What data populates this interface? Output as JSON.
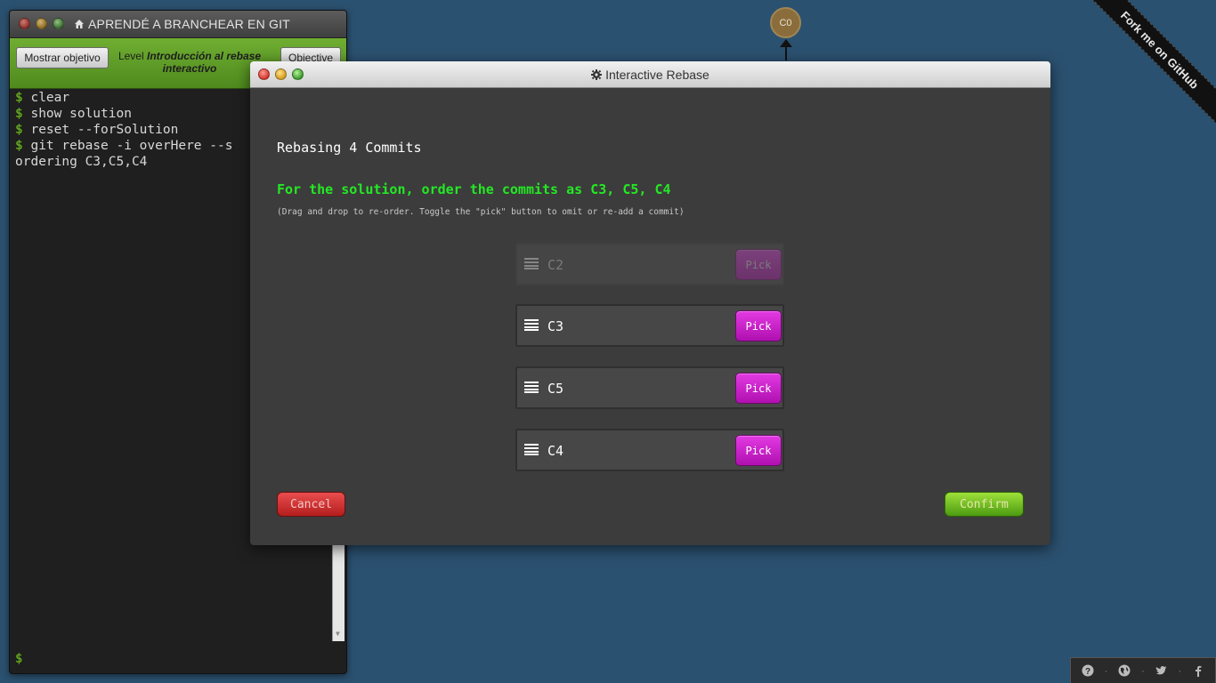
{
  "terminal": {
    "title": "APRENDÉ A BRANCHEAR EN GIT",
    "show_goal_label": "Mostrar objetivo",
    "level_prefix": "Level",
    "level_name": "Introducción al rebase interactivo",
    "objective_label": "Objective",
    "lines": [
      {
        "prompt": "$",
        "text": "clear"
      },
      {
        "prompt": "$",
        "text": "show solution"
      },
      {
        "prompt": "$",
        "text": "reset --forSolution"
      },
      {
        "prompt": "$",
        "text": "git rebase -i overHere --s"
      },
      {
        "prompt": "",
        "text": "ordering C3,C5,C4"
      }
    ],
    "bottom_prompt": "$"
  },
  "graph": {
    "node_label": "C0"
  },
  "ribbon": {
    "text": "Fork me on GitHub"
  },
  "dialog": {
    "title": "Interactive Rebase",
    "heading": "Rebasing 4 Commits",
    "solution": "For the solution, order the commits as C3, C5, C4",
    "hint": "(Drag and drop to re-order. Toggle the \"pick\" button to omit or re-add a commit)",
    "commits": [
      {
        "id": "C2",
        "button": "Pick",
        "enabled": false
      },
      {
        "id": "C3",
        "button": "Pick",
        "enabled": true
      },
      {
        "id": "C5",
        "button": "Pick",
        "enabled": true
      },
      {
        "id": "C4",
        "button": "Pick",
        "enabled": true
      }
    ],
    "cancel_label": "Cancel",
    "confirm_label": "Confirm"
  },
  "helper_bar": {
    "icons": [
      "help-icon",
      "globe-icon",
      "twitter-icon",
      "facebook-icon"
    ],
    "separator": "·"
  },
  "colors": {
    "background": "#2b5170",
    "prompt": "#5fa31f",
    "solution_text": "#24e824",
    "pick_button": "#c81ec8",
    "cancel_button": "#d03232",
    "confirm_button": "#6cbf1f"
  }
}
